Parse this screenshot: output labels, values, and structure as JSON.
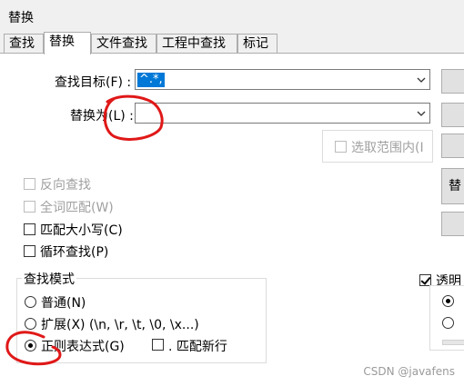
{
  "window": {
    "title": "替换"
  },
  "tabs": [
    "查找",
    "替换",
    "文件查找",
    "工程中查找",
    "标记"
  ],
  "form": {
    "find_label": "查找目标(F) :",
    "find_value": "^.*,",
    "replace_label": "替换为(L) :",
    "replace_value": "",
    "in_selection_label": "选取范围内(I"
  },
  "options": {
    "backward": "反向查找",
    "whole_word": "全词匹配(W)",
    "match_case": "匹配大小写(C)",
    "wrap": "循环查找(P)"
  },
  "search_mode": {
    "title": "查找模式",
    "normal": "普通(N)",
    "extended": "扩展(X) (\\n, \\r, \\t, \\0, \\x...)",
    "regex": "正则表达式(G)",
    "dot_newline": ". 匹配新行"
  },
  "right_buttons": {
    "replace_all_partial": "替"
  },
  "transparency": {
    "label": "透明"
  },
  "watermark": "CSDN @javafens",
  "colors": {
    "accent": "#0078d7",
    "annotation": "#e01818"
  }
}
